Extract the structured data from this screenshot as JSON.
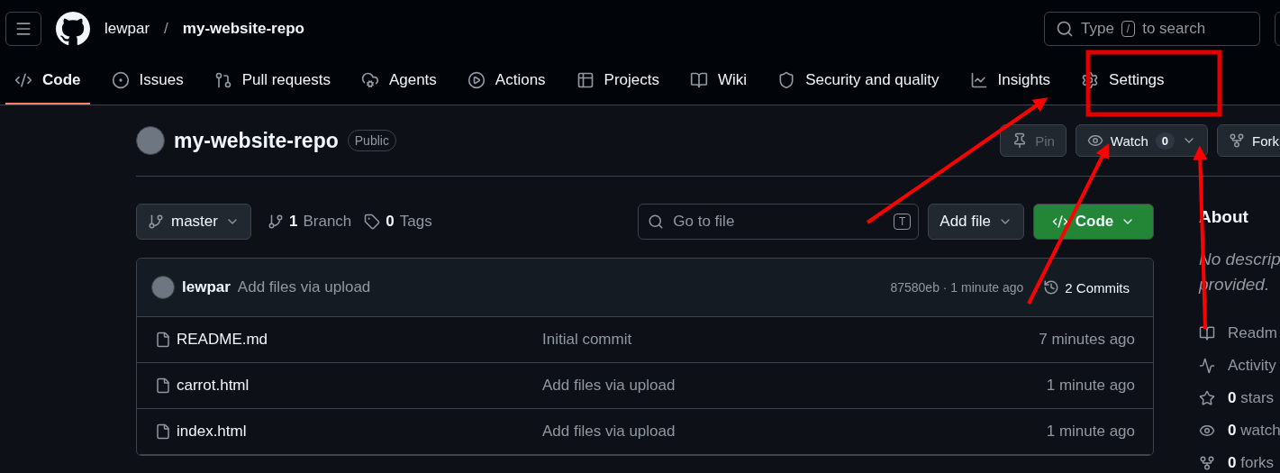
{
  "header": {
    "owner": "lewpar",
    "separator": "/",
    "repo": "my-website-repo",
    "search": {
      "placeholder_before": "Type",
      "key": "/",
      "placeholder_after": "to search"
    }
  },
  "tabs": [
    {
      "label": "Code",
      "selected": true
    },
    {
      "label": "Issues",
      "selected": false
    },
    {
      "label": "Pull requests",
      "selected": false
    },
    {
      "label": "Agents",
      "selected": false
    },
    {
      "label": "Actions",
      "selected": false
    },
    {
      "label": "Projects",
      "selected": false
    },
    {
      "label": "Wiki",
      "selected": false
    },
    {
      "label": "Security and quality",
      "selected": false
    },
    {
      "label": "Insights",
      "selected": false
    },
    {
      "label": "Settings",
      "selected": false
    }
  ],
  "repo_header": {
    "name": "my-website-repo",
    "visibility": "Public",
    "pin": {
      "label": "Pin",
      "disabled": true
    },
    "watch": {
      "label": "Watch",
      "count": "0"
    },
    "fork": {
      "label": "Fork"
    }
  },
  "toolbar": {
    "branch": "master",
    "branches_count": "1",
    "branches_label": "Branch",
    "tags_count": "0",
    "tags_label": "Tags",
    "go_to_file": {
      "placeholder": "Go to file",
      "key": "T"
    },
    "add_file": "Add file",
    "code": "Code"
  },
  "latest_commit": {
    "author": "lewpar",
    "message": "Add files via upload",
    "hash": "87580eb",
    "dot": "·",
    "time": "1 minute ago",
    "commits_count": "2",
    "commits_label": "Commits"
  },
  "files": [
    {
      "name": "README.md",
      "message": "Initial commit",
      "time": "7 minutes ago"
    },
    {
      "name": "carrot.html",
      "message": "Add files via upload",
      "time": "1 minute ago"
    },
    {
      "name": "index.html",
      "message": "Add files via upload",
      "time": "1 minute ago"
    }
  ],
  "about": {
    "title": "About",
    "description_lines": [
      "No descrip",
      "provided."
    ],
    "items": [
      {
        "label": "Readm"
      },
      {
        "label": "Activity"
      },
      {
        "count": "0",
        "label": "stars"
      },
      {
        "count": "0",
        "label": "watch"
      },
      {
        "count": "0",
        "label": "forks"
      }
    ]
  },
  "annotations": [
    {
      "kind": "frame"
    },
    {
      "kind": "arrow"
    },
    {
      "kind": "arrow"
    },
    {
      "kind": "arrow"
    }
  ]
}
